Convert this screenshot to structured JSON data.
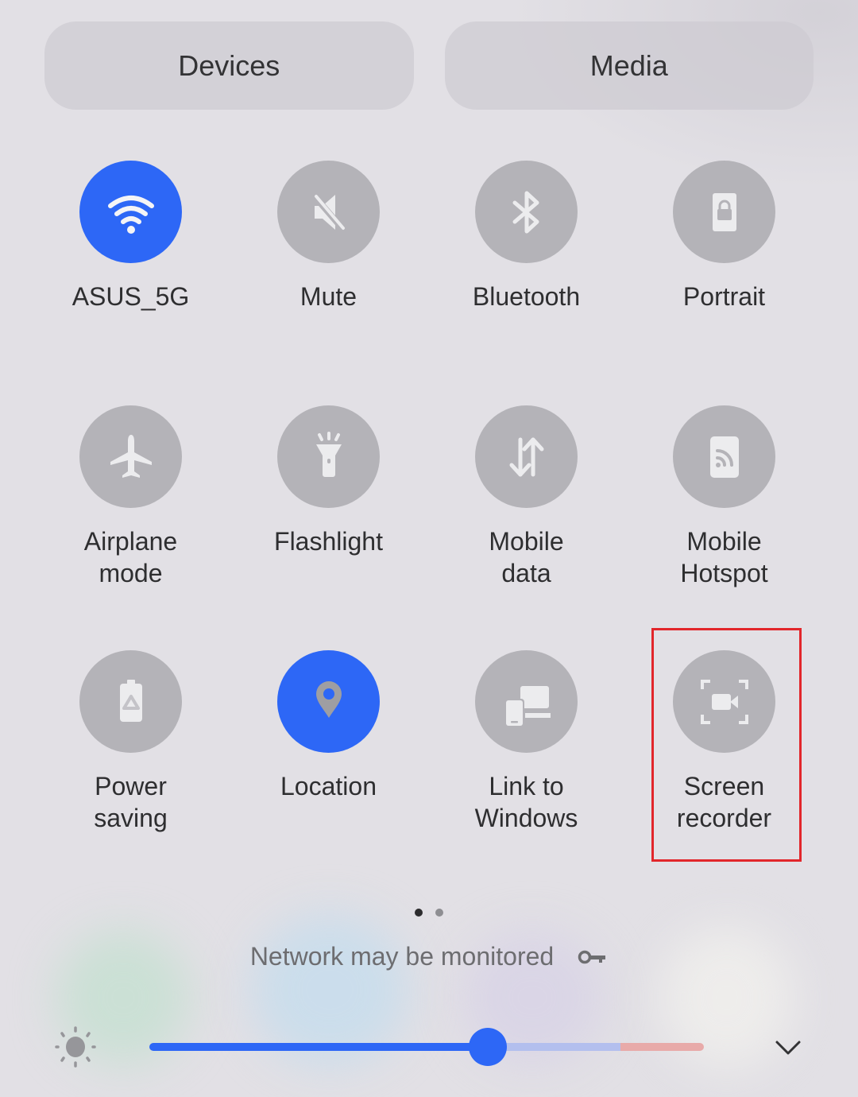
{
  "top_buttons": {
    "devices_label": "Devices",
    "media_label": "Media"
  },
  "tiles": [
    {
      "label": "ASUS_5G",
      "icon": "wifi-icon",
      "state": "on"
    },
    {
      "label": "Mute",
      "icon": "mute-icon",
      "state": "off"
    },
    {
      "label": "Bluetooth",
      "icon": "bluetooth-icon",
      "state": "off"
    },
    {
      "label": "Portrait",
      "icon": "portrait-lock-icon",
      "state": "off"
    },
    {
      "label": "Airplane\nmode",
      "icon": "airplane-icon",
      "state": "off"
    },
    {
      "label": "Flashlight",
      "icon": "flashlight-icon",
      "state": "off"
    },
    {
      "label": "Mobile\ndata",
      "icon": "mobile-data-icon",
      "state": "off"
    },
    {
      "label": "Mobile\nHotspot",
      "icon": "hotspot-icon",
      "state": "off"
    },
    {
      "label": "Power\nsaving",
      "icon": "power-saving-icon",
      "state": "off"
    },
    {
      "label": "Location",
      "icon": "location-icon",
      "state": "on"
    },
    {
      "label": "Link to\nWindows",
      "icon": "link-to-windows-icon",
      "state": "off"
    },
    {
      "label": "Screen\nrecorder",
      "icon": "screen-recorder-icon",
      "state": "off",
      "highlighted": true
    }
  ],
  "pagination": {
    "current_page": 1,
    "total_pages": 2
  },
  "network_notice": {
    "text": "Network may be monitored",
    "icon": "vpn-key-icon"
  },
  "brightness": {
    "level": 0.61,
    "comfort_threshold": 0.85,
    "icon": "sun-icon",
    "expand_icon": "chevron-down-icon"
  },
  "colors": {
    "accent": "#2d67f6",
    "tile_off": "#b4b3b8",
    "highlight_box": "#e2262b",
    "slider_light": "#b3bfee",
    "slider_warn": "#e8aaa9"
  }
}
